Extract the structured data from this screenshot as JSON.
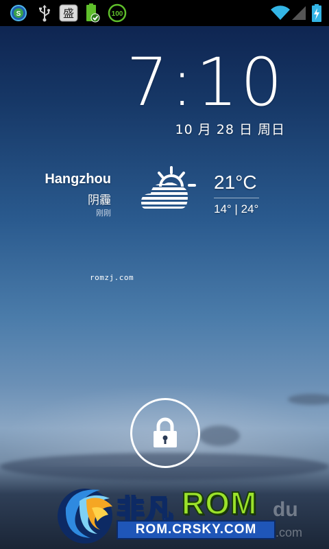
{
  "status_bar": {
    "icons_left": [
      "app-s-icon",
      "usb-icon",
      "sheng-app-icon",
      "battery-charged-icon",
      "100-badge-icon"
    ],
    "sheng_char": "盛",
    "badge_text": "100",
    "icons_right": [
      "wifi-icon",
      "signal-icon",
      "battery-charging-icon"
    ]
  },
  "clock": {
    "time": "7:10",
    "date": "10 月 28 日 周日"
  },
  "weather": {
    "city": "Hangzhou",
    "condition": "阴霾",
    "updated": "刚刚",
    "icon": "partly-cloudy-haze-icon",
    "temp": "21°C",
    "range": "14° | 24°"
  },
  "watermark": {
    "mid_text": "romzj.com",
    "brand_cn": "非凡",
    "brand_rom": "ROM",
    "url": "ROM.CRSKY.COM",
    "faint_du": "du",
    "faint_com": ".com"
  },
  "lock": {
    "icon": "padlock-icon"
  },
  "colors": {
    "brand_green": "#9be22b",
    "brand_blue": "#1f56b8",
    "status_bar": "#000000",
    "accent_green": "#5fbf2b"
  }
}
